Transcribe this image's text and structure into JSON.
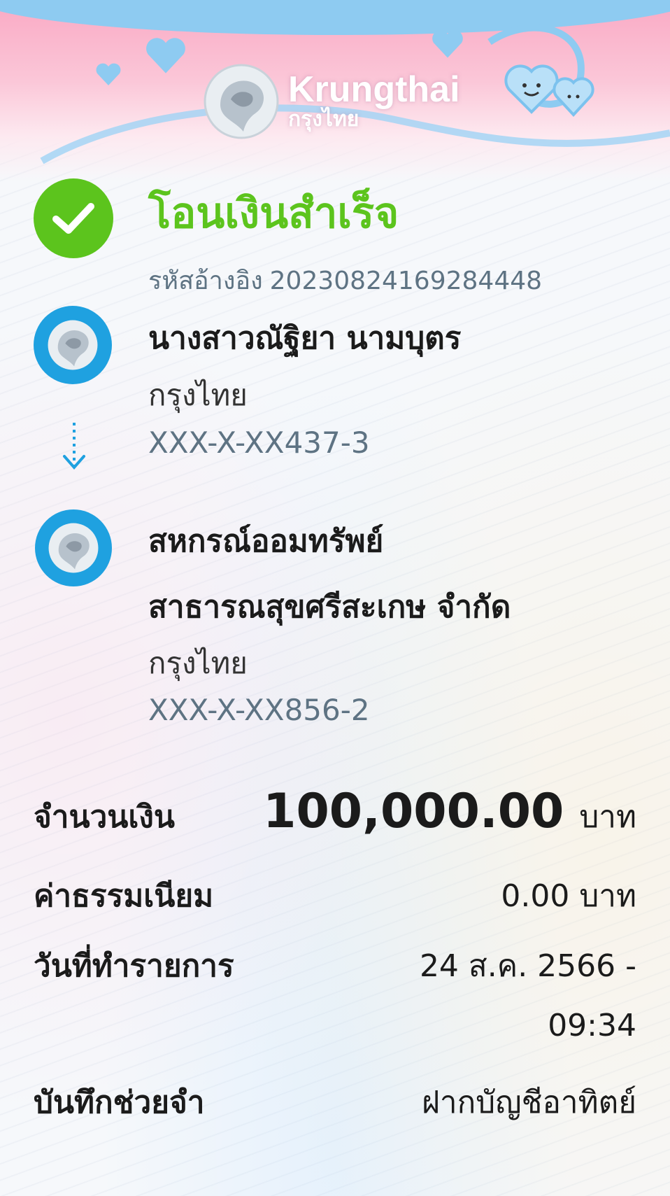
{
  "header": {
    "brand_en": "Krungthai",
    "brand_th": "กรุงไทย"
  },
  "status": {
    "title": "โอนเงินสำเร็จ",
    "ref_label": "รหัสอ้างอิง",
    "ref_value": "2023082416928444​8"
  },
  "sender": {
    "name": "นางสาวณัฐิยา นามบุตร",
    "bank": "กรุงไทย",
    "account": "XXX-X-XX437-3"
  },
  "receiver": {
    "name_line1": "สหกรณ์ออมทรัพย์",
    "name_line2": "สาธารณสุขศรีสะเกษ จำกัด",
    "bank": "กรุงไทย",
    "account": "XXX-X-XX856-2"
  },
  "details": {
    "amount_label": "จำนวนเงิน",
    "amount_value": "100,000.00",
    "amount_unit": "บาท",
    "fee_label": "ค่าธรรมเนียม",
    "fee_value": "0.00 บาท",
    "date_label": "วันที่ทำรายการ",
    "date_value": "24 ส.ค. 2566 -",
    "time_value": "09:34",
    "memo_label": "บันทึกช่วยจำ",
    "memo_value": "ฝากบัญชีอาทิตย์"
  },
  "colors": {
    "success": "#5cc41d",
    "brand_blue": "#1fa1e0",
    "muted": "#5e7383"
  }
}
